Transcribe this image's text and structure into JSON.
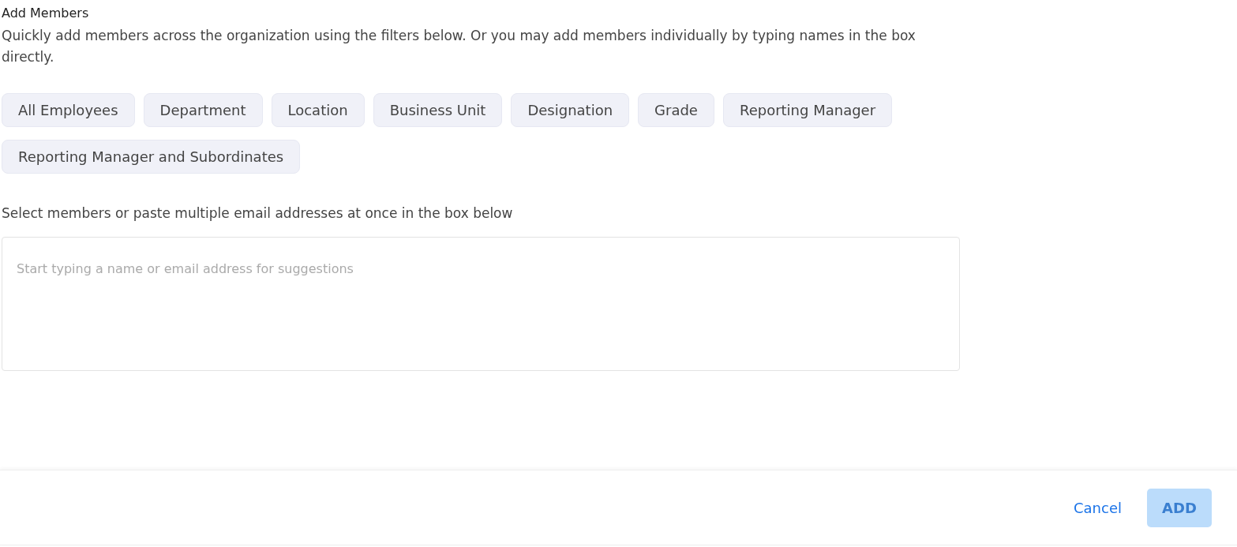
{
  "title": "Add Members",
  "description": "Quickly add members across the organization using the filters below. Or you may add members individually by typing names in the box directly.",
  "filters": [
    {
      "label": "All Employees"
    },
    {
      "label": "Department"
    },
    {
      "label": "Location"
    },
    {
      "label": "Business Unit"
    },
    {
      "label": "Designation"
    },
    {
      "label": "Grade"
    },
    {
      "label": "Reporting Manager"
    },
    {
      "label": "Reporting Manager and Subordinates"
    }
  ],
  "members_field": {
    "label": "Select members or paste multiple email addresses at once in the box below",
    "placeholder": "Start typing a name or email address for suggestions"
  },
  "footer": {
    "cancel": "Cancel",
    "submit": {
      "label": "ADD",
      "disabled": true
    }
  }
}
